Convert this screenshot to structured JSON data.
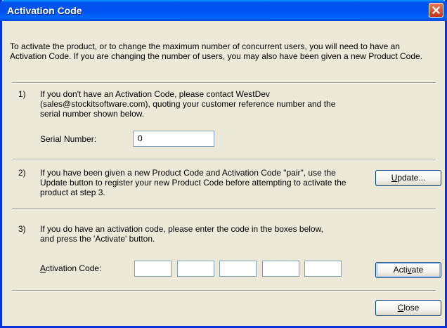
{
  "window": {
    "title": "Activation Code",
    "close_icon": "close-x-icon"
  },
  "intro": {
    "text": "To activate the product, or to change the maximum number of concurrent users, you will need to have an Activation Code. If you are changing the number of users, you may also have been given a new Product Code."
  },
  "steps": [
    {
      "number": "1)",
      "text": "If you don't have an Activation Code, please contact WestDev (sales@stockitsoftware.com), quoting your customer reference number and the serial number shown below."
    },
    {
      "number": "2)",
      "text": "If you have been given a new Product Code and Activation Code \"pair\", use the Update button to register your new Product Code before attempting to activate the product at step 3."
    },
    {
      "number": "3)",
      "text": "If you do have an activation code, please enter the code in the boxes below, and press the 'Activate' button."
    }
  ],
  "serial": {
    "label": "Serial Number:",
    "value": "0"
  },
  "activation": {
    "label_mnemonic": "A",
    "label_rest": "ctivation Code:",
    "boxes": [
      "",
      "",
      "",
      "",
      ""
    ]
  },
  "buttons": {
    "update_mnemonic": "U",
    "update_rest": "pdate...",
    "activate_pre": "Acti",
    "activate_mnemonic": "v",
    "activate_post": "ate",
    "close_mnemonic": "C",
    "close_rest": "lose"
  }
}
